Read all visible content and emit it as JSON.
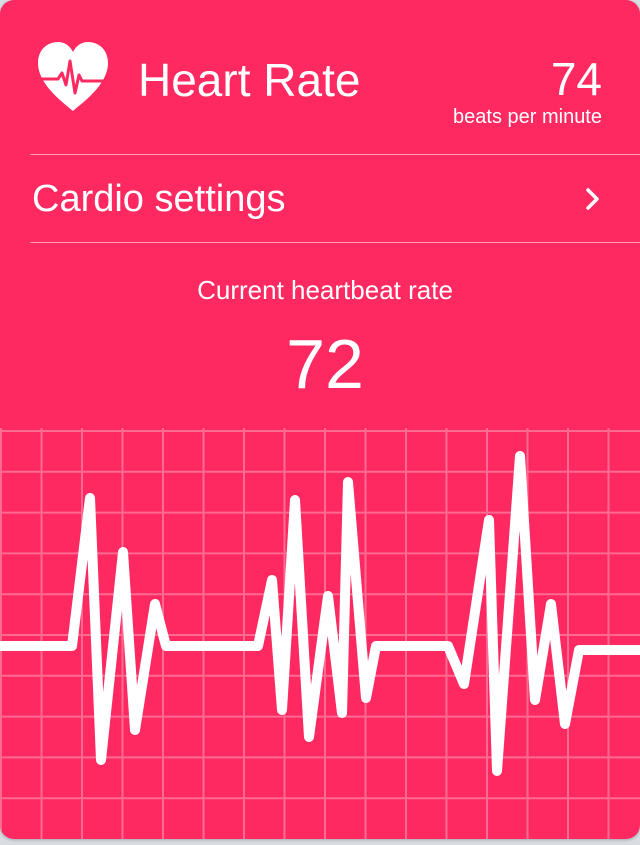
{
  "header": {
    "title": "Heart Rate",
    "bpm_value": "74",
    "bpm_unit": "beats per minute",
    "icon": "heart-pulse-icon"
  },
  "settings": {
    "label": "Cardio settings",
    "icon": "chevron-right-icon"
  },
  "current": {
    "caption": "Current heartbeat rate",
    "value": "72"
  },
  "colors": {
    "card_background": "#ff2962",
    "grid_lines": "#ff6a92",
    "text": "#ffffff"
  }
}
